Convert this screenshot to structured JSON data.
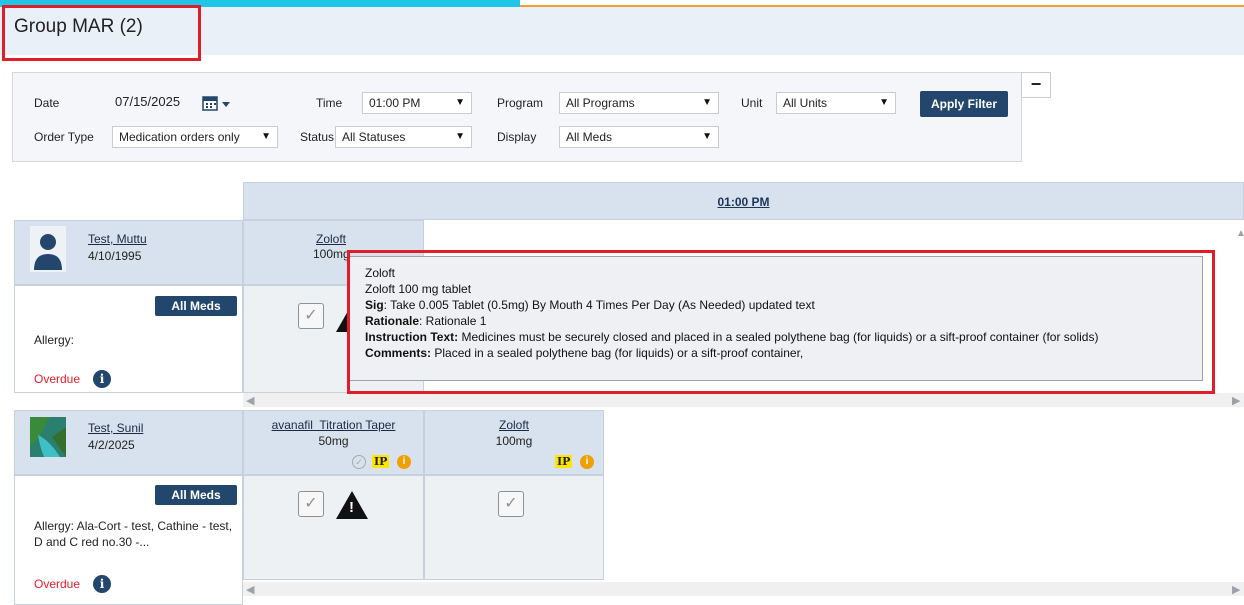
{
  "page": {
    "title": "Group MAR (2)"
  },
  "filters": {
    "date_label": "Date",
    "date_value": "07/15/2025",
    "time_label": "Time",
    "time_value": "01:00 PM",
    "program_label": "Program",
    "program_value": "All Programs",
    "unit_label": "Unit",
    "unit_value": "All Units",
    "apply_label": "Apply Filter",
    "order_type_label": "Order Type",
    "order_type_value": "Medication orders only",
    "status_label": "Status",
    "status_value": "All Statuses",
    "display_label": "Display",
    "display_value": "All Meds",
    "collapse_symbol": "−"
  },
  "grid": {
    "time_header": "01:00 PM"
  },
  "patients": [
    {
      "name": "Test, Muttu",
      "dob": "4/10/1995",
      "meds_button": "All Meds",
      "allergy": "Allergy:",
      "overdue": "Overdue",
      "meds": [
        {
          "name": "Zoloft",
          "dose": "100mg"
        }
      ]
    },
    {
      "name": "Test, Sunil",
      "dob": "4/2/2025",
      "meds_button": "All Meds",
      "allergy": "Allergy: Ala-Cort - test, Cathine - test, D and C red no.30 -...",
      "overdue": "Overdue",
      "meds": [
        {
          "name": "avanafil  Titration Taper",
          "dose": "50mg",
          "badge": "IP"
        },
        {
          "name": "Zoloft",
          "dose": "100mg",
          "badge": "IP"
        }
      ]
    }
  ],
  "tooltip": {
    "line1": "Zoloft",
    "line2": "Zoloft 100 mg tablet",
    "sig_label": "Sig",
    "sig_text": ": Take 0.005 Tablet (0.5mg) By Mouth 4 Times Per Day (As Needed) updated text",
    "rationale_label": "Rationale",
    "rationale_text": ": Rationale 1",
    "instruction_label": "Instruction Text:",
    "instruction_text": " Medicines must be securely closed and placed in a sealed polythene bag (for liquids) or a sift-proof container (for solids)",
    "comments_label": "Comments:",
    "comments_text": " Placed in a sealed polythene bag (for liquids) or a sift-proof container,"
  },
  "icons": {
    "calendar": "calendar-icon",
    "chevron": "chevron-down-icon",
    "user": "user-avatar-icon",
    "info": "info-icon",
    "check": "checkbox-icon",
    "warning": "warning-icon"
  },
  "colors": {
    "navy": "#23466c",
    "header_blue": "#d7e2ee",
    "highlight_red": "#e11d2a",
    "overdue_red": "#e11d2a",
    "ip_yellow": "#ffe600"
  }
}
